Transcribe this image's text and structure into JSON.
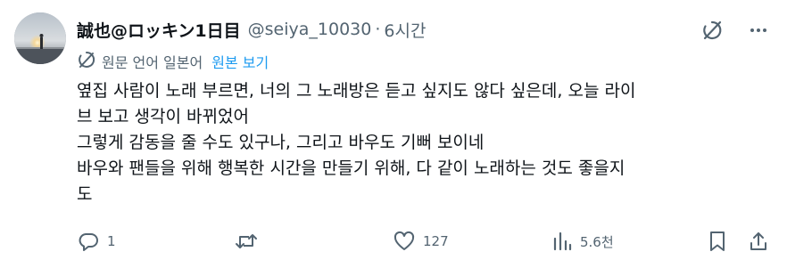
{
  "author": {
    "display_name": "誠也@ロッキン1日目",
    "handle": "@seiya_10030",
    "separator": "·",
    "time": "6시간"
  },
  "translation": {
    "note": "원문 언어 일본어",
    "show_original": "원본 보기"
  },
  "tweet": {
    "lines": [
      "옆집 사람이 노래 부르면, 너의 그 노래방은 듣고 싶지도 않다 싶은데, 오늘 라이",
      "브 보고 생각이 바뀌었어",
      "그렇게 감동을 줄 수도 있구나, 그리고 바우도 기뻐 보이네",
      "바우와 팬들을 위해 행복한 시간을 만들기 위해, 다 같이 노래하는 것도 좋을지",
      "도"
    ]
  },
  "actions": {
    "reply": {
      "icon": "reply-icon",
      "count": "1"
    },
    "repost": {
      "icon": "repost-icon",
      "count": ""
    },
    "like": {
      "icon": "heart-icon",
      "count": "127"
    },
    "views": {
      "icon": "views-icon",
      "count": "5.6천"
    },
    "bookmark": {
      "icon": "bookmark-icon"
    },
    "share": {
      "icon": "share-icon"
    }
  },
  "top_icons": [
    "grok-icon",
    "more-icon"
  ],
  "colors": {
    "text": "#0f1419",
    "secondary": "#536471",
    "link": "#1d9bf0",
    "background": "#ffffff"
  }
}
